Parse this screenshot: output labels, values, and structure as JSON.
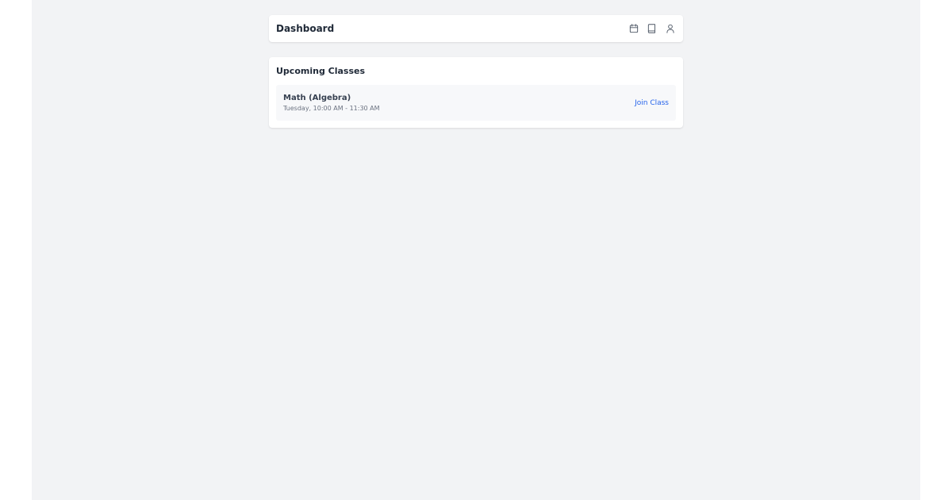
{
  "header": {
    "title": "Dashboard",
    "icons": [
      "calendar-icon",
      "book-icon",
      "user-icon"
    ]
  },
  "upcoming": {
    "title": "Upcoming Classes",
    "classes": [
      {
        "name": "Math (Algebra)",
        "time": "Tuesday, 10:00 AM - 11:30 AM",
        "action_label": "Join Class"
      }
    ]
  },
  "colors": {
    "background": "#f2f3f5",
    "card": "#ffffff",
    "accent": "#2563eb",
    "title_text": "#1f2937"
  }
}
